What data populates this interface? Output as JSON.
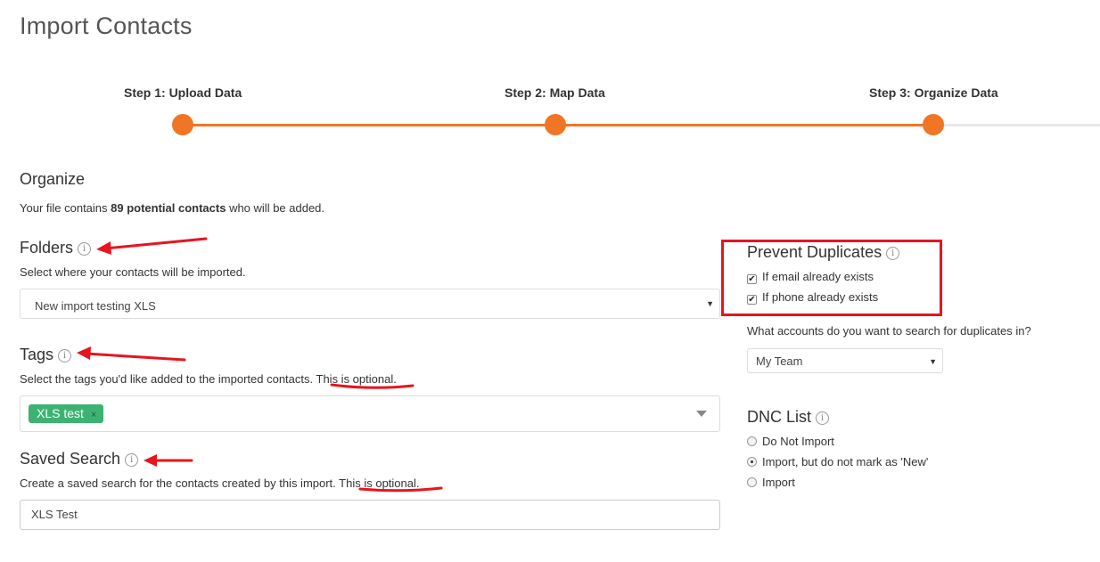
{
  "page": {
    "title": "Import Contacts"
  },
  "stepper": {
    "steps": [
      {
        "label": "Step 1: Upload Data"
      },
      {
        "label": "Step 2: Map Data"
      },
      {
        "label": "Step 3: Organize Data"
      }
    ],
    "progress_color": "#f07524",
    "track_color": "#e8e8e8"
  },
  "organize": {
    "title": "Organize",
    "description_prefix": "Your file contains ",
    "description_bold": "89 potential contacts",
    "description_suffix": " who will be added."
  },
  "folders": {
    "title": "Folders",
    "description": "Select where your contacts will be imported.",
    "selected": "New import testing XLS"
  },
  "tags": {
    "title": "Tags",
    "description": "Select the tags you'd like added to the imported contacts. ",
    "optional_text": "This is optional",
    "selected_tags": [
      {
        "label": "XLS test",
        "remove": "×"
      }
    ]
  },
  "saved_search": {
    "title": "Saved Search",
    "description": "Create a saved search for the contacts created by this import. ",
    "optional_text": "This is optional",
    "value": "XLS Test"
  },
  "prevent_duplicates": {
    "title": "Prevent Duplicates",
    "options": [
      {
        "label": "If email already exists",
        "checked": true
      },
      {
        "label": "If phone already exists",
        "checked": true
      }
    ],
    "question": "What accounts do you want to search for duplicates in?",
    "selected": "My Team"
  },
  "dnc_list": {
    "title": "DNC List",
    "options": [
      {
        "label": "Do Not Import",
        "selected": false
      },
      {
        "label": "Import, but do not mark as 'New'",
        "selected": true
      },
      {
        "label": "Import",
        "selected": false
      }
    ]
  },
  "icons": {
    "info": "info-icon",
    "caret": "caret-down-icon",
    "check": "check-icon"
  },
  "annotation_color": "#e8141e"
}
